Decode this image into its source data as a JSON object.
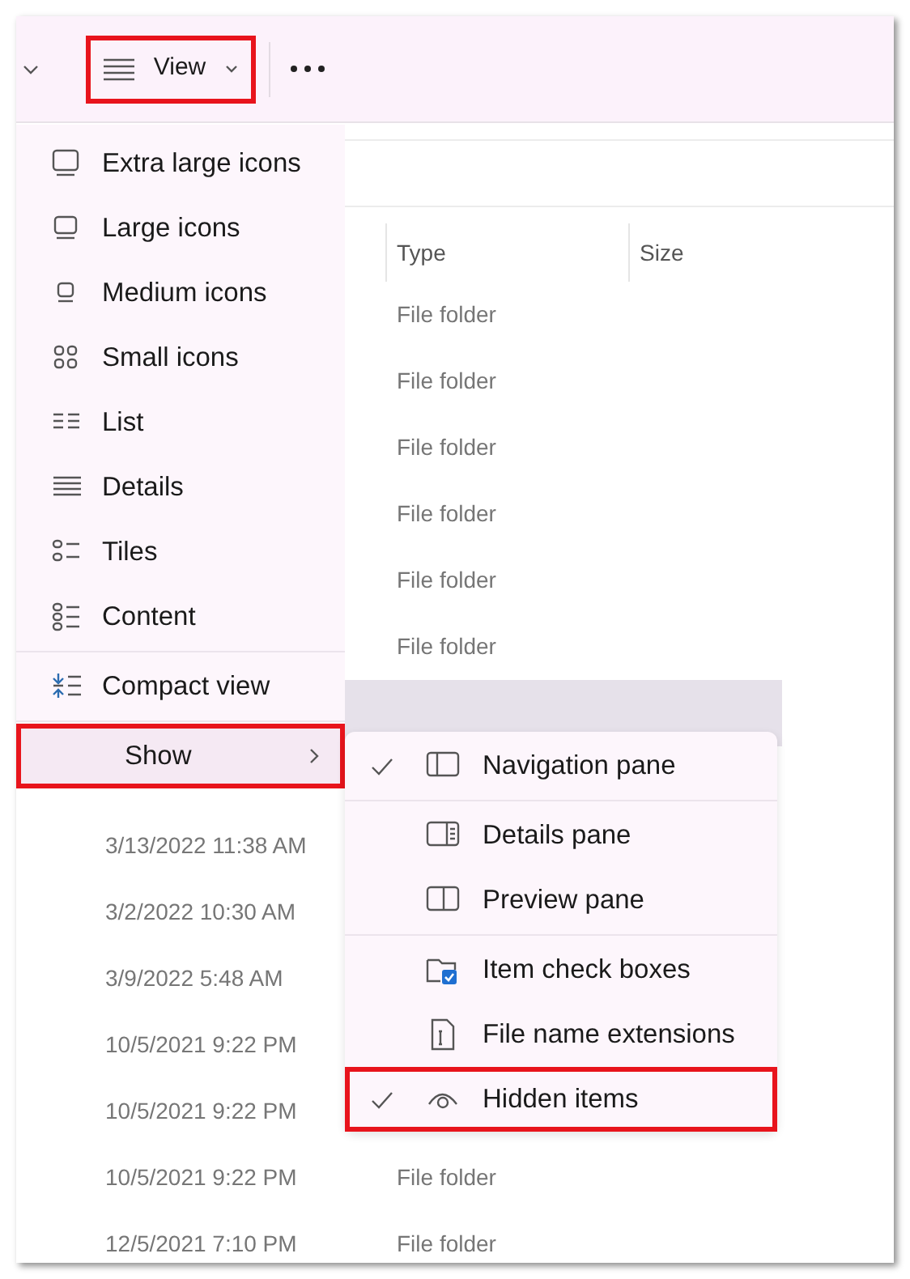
{
  "toolbar": {
    "view_button": {
      "label": "View",
      "highlighted": true
    }
  },
  "file_list": {
    "columns": [
      "Type",
      "Size"
    ],
    "rows": [
      {
        "type": "File folder",
        "selected": false
      },
      {
        "type": "File folder",
        "selected": false
      },
      {
        "type": "File folder",
        "selected": false
      },
      {
        "type": "File folder",
        "selected": false
      },
      {
        "type": "File folder",
        "selected": false
      },
      {
        "type": "File folder",
        "selected": false
      },
      {
        "selected": true
      },
      {
        "selected": false
      },
      {
        "date": "3/13/2022 11:38 AM",
        "selected": false
      },
      {
        "date": "3/2/2022 10:30 AM",
        "selected": false
      },
      {
        "date": "3/9/2022 5:48 AM",
        "selected": false
      },
      {
        "date": "10/5/2021 9:22 PM",
        "selected": false
      },
      {
        "date": "10/5/2021 9:22 PM",
        "selected": false
      },
      {
        "date": "10/5/2021 9:22 PM",
        "type": "File folder",
        "selected": false
      },
      {
        "date": "12/5/2021 7:10 PM",
        "type": "File folder",
        "selected": false
      }
    ]
  },
  "view_menu": {
    "items": [
      {
        "label": "Extra large icons",
        "hovered": false,
        "highlighted": false
      },
      {
        "label": "Large icons",
        "hovered": false,
        "highlighted": false
      },
      {
        "label": "Medium icons",
        "hovered": false,
        "highlighted": false
      },
      {
        "label": "Small icons",
        "hovered": false,
        "highlighted": false
      },
      {
        "label": "List",
        "hovered": false,
        "highlighted": false
      },
      {
        "label": "Details",
        "hovered": false,
        "highlighted": false
      },
      {
        "label": "Tiles",
        "hovered": false,
        "highlighted": false
      },
      {
        "label": "Content",
        "hovered": false,
        "highlighted": false
      },
      {
        "label": "Compact view",
        "hovered": false,
        "highlighted": false
      },
      {
        "label": "Show",
        "hovered": true,
        "highlighted": true,
        "has_submenu": true
      }
    ]
  },
  "show_submenu": {
    "items": [
      {
        "label": "Navigation pane",
        "checked": true,
        "highlighted": false
      },
      {
        "label": "Details pane",
        "checked": false,
        "highlighted": false
      },
      {
        "label": "Preview pane",
        "checked": false,
        "highlighted": false
      },
      {
        "label": "Item check boxes",
        "checked": false,
        "highlighted": false
      },
      {
        "label": "File name extensions",
        "checked": false,
        "highlighted": false
      },
      {
        "label": "Hidden items",
        "checked": true,
        "highlighted": true
      }
    ]
  }
}
